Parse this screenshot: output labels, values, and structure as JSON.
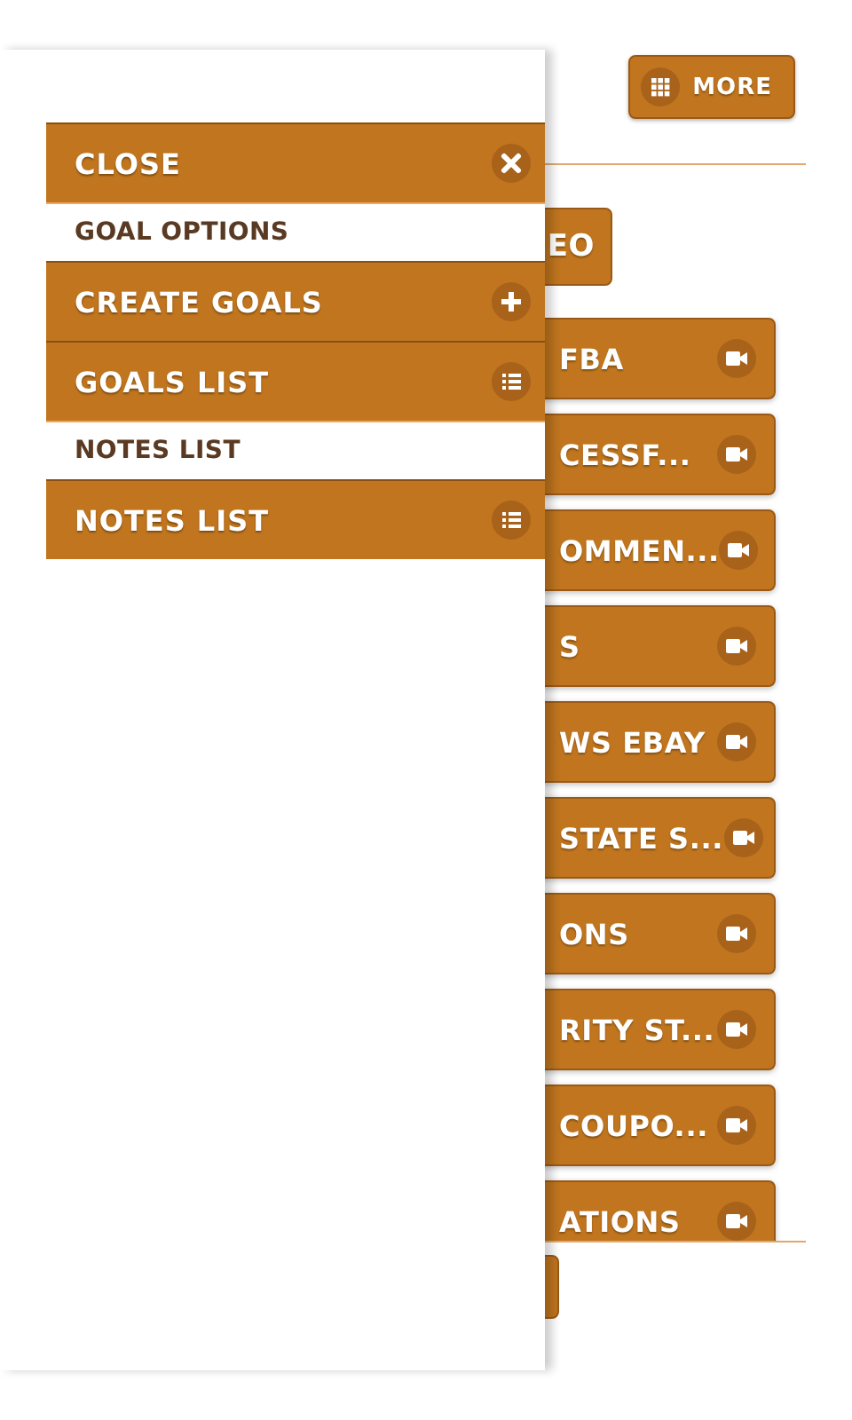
{
  "header": {
    "more_button": {
      "label": "MORE"
    }
  },
  "content": {
    "top_button": {
      "label": "EO"
    },
    "video_buttons": [
      {
        "label": "FBA"
      },
      {
        "label": "CESSF..."
      },
      {
        "label": "OMMEN..."
      },
      {
        "label": "S"
      },
      {
        "label": "WS EBAY"
      },
      {
        "label": "STATE S..."
      },
      {
        "label": "ONS"
      },
      {
        "label": "RITY ST..."
      },
      {
        "label": "COUPO..."
      },
      {
        "label": "ATIONS"
      }
    ]
  },
  "drawer": {
    "items": [
      {
        "kind": "close",
        "label": "CLOSE"
      },
      {
        "kind": "heading",
        "label": "GOAL OPTIONS"
      },
      {
        "kind": "add",
        "label": "CREATE GOALS"
      },
      {
        "kind": "list",
        "label": "GOALS LIST"
      },
      {
        "kind": "heading",
        "label": "NOTES LIST"
      },
      {
        "kind": "list",
        "label": "NOTES LIST"
      }
    ]
  }
}
